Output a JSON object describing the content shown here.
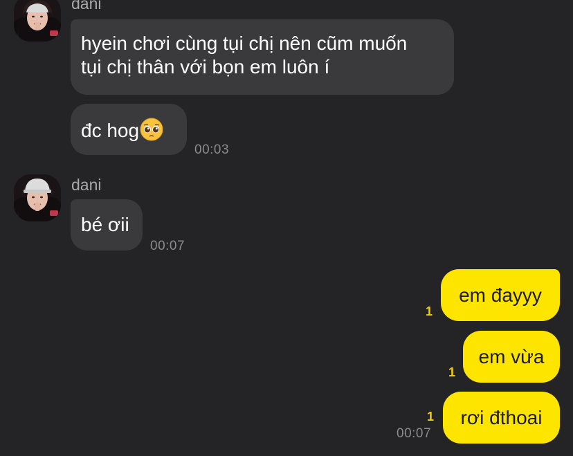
{
  "chat": {
    "groups": [
      {
        "sender": "dani",
        "messages": [
          {
            "line1": "hyein chơi cùng tụi chị nên cũm muốn",
            "line2": "tụi chị thân với bọn em luôn í"
          },
          {
            "text": "đc hog",
            "emoji": "pleading-face-emoji",
            "time": "00:03"
          }
        ]
      },
      {
        "sender": "dani",
        "messages": [
          {
            "text": "bé ơii",
            "time": "00:07"
          }
        ]
      }
    ],
    "outgoing": [
      {
        "text": "em đayyy",
        "unread": "1"
      },
      {
        "text": "em vừa",
        "unread": "1"
      },
      {
        "text": "rơi đthoai",
        "unread": "1",
        "time": "00:07"
      }
    ]
  },
  "colors": {
    "background": "#242427",
    "incoming_bubble": "#3a3a3d",
    "outgoing_bubble": "#fee500",
    "unread_count": "#f5d000"
  }
}
